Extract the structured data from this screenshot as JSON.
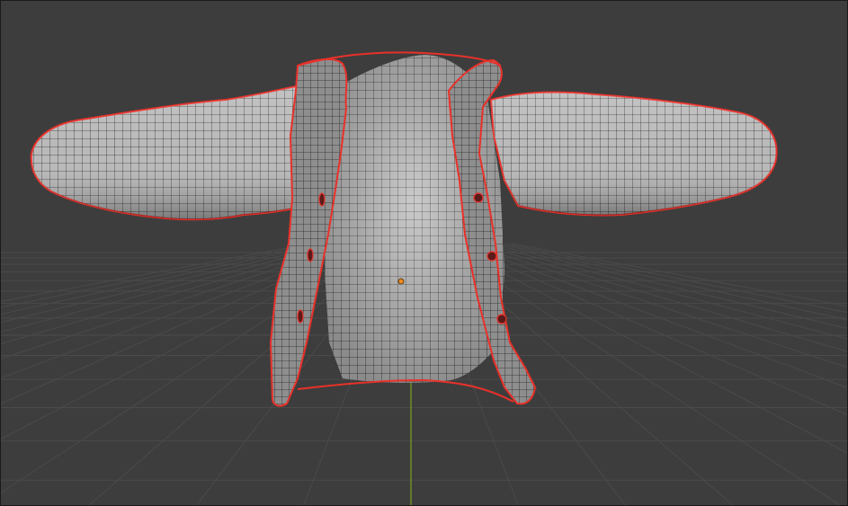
{
  "viewport": {
    "mode": "3d-viewport",
    "background_color": "#3d3d3d",
    "grid_color": "#4a4a4a",
    "y_axis_color": "#7aa01a",
    "selection_outline_color": "#e8312a",
    "mesh_fill_color": "#b8b8b8",
    "wire_color": "#2a2a2a",
    "origin_color": "#f08a1c"
  },
  "object": {
    "kind": "jacket-mesh",
    "selected": true,
    "buttons": 6
  }
}
